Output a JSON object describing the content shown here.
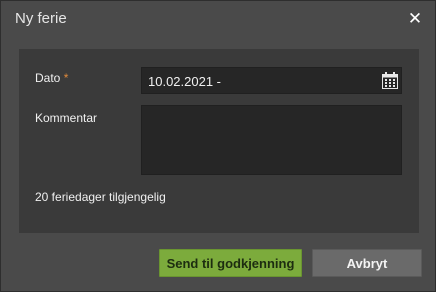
{
  "dialog": {
    "title": "Ny ferie",
    "close_symbol": "✕"
  },
  "form": {
    "date_label": "Dato",
    "required_marker": "*",
    "date_value": "10.02.2021 -",
    "comment_label": "Kommentar",
    "comment_value": "",
    "info_text": "20 feriedager tilgjengelig"
  },
  "buttons": {
    "submit_label": "Send til godkjenning",
    "cancel_label": "Avbryt"
  },
  "colors": {
    "dialog_bg": "#4a4a4a",
    "panel_bg": "#3a3a3a",
    "input_bg": "#262626",
    "primary": "#7cab3c",
    "secondary": "#6a6a6a",
    "required": "#e08a3c"
  },
  "icons": {
    "close": "close-icon",
    "calendar": "calendar-icon"
  }
}
